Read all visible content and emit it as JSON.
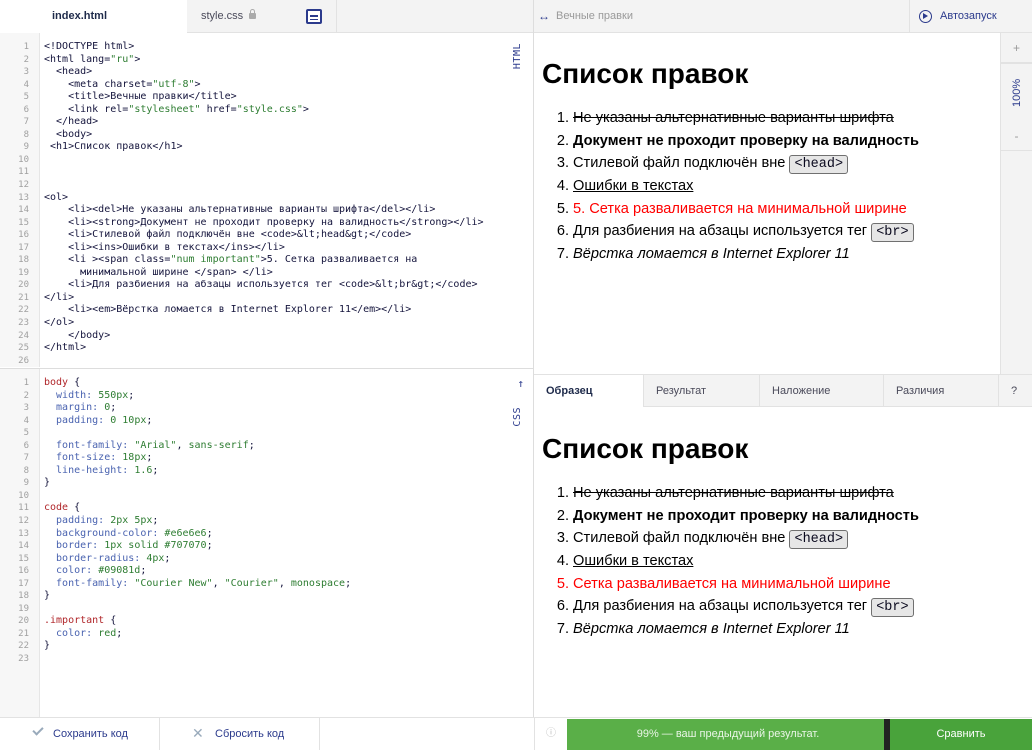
{
  "tabs": {
    "html_file": "index.html",
    "css_file": "style.css"
  },
  "preview": {
    "title": "Вечные правки",
    "autorun": "Автозапуск",
    "zoom_in": "+",
    "zoom_level": "100%",
    "zoom_out": "-"
  },
  "editors": {
    "html_label": "HTML",
    "css_label": "CSS",
    "html_line_count": 24,
    "css_line_count": 23
  },
  "page": {
    "heading": "Список правок",
    "items": [
      {
        "num": "1.",
        "text": "Не указаны альтернативные варианты шрифта"
      },
      {
        "num": "2.",
        "text": "Документ не проходит проверку на валидность"
      },
      {
        "num": "3.",
        "text": "Стилевой файл подключён вне ",
        "code": "<head>"
      },
      {
        "num": "4.",
        "text": "Ошибки в текстах"
      },
      {
        "num": "5.",
        "text": "5. Сетка разваливается на минимальной ширине"
      },
      {
        "num": "6.",
        "text": "Для разбиения на абзацы используется тег ",
        "code": "<br>"
      },
      {
        "num": "7.",
        "text": "Вёрстка ломается в Internet Explorer 11"
      }
    ]
  },
  "sample": {
    "heading": "Список правок",
    "items": [
      {
        "num": "1.",
        "text": "Не указаны альтернативные варианты шрифта"
      },
      {
        "num": "2.",
        "text": "Документ не проходит проверку на валидность"
      },
      {
        "num": "3.",
        "text": "Стилевой файл подключён вне ",
        "code": "<head>"
      },
      {
        "num": "4.",
        "text": "Ошибки в текстах"
      },
      {
        "num": "5.",
        "text": "Сетка разваливается на минимальной ширине"
      },
      {
        "num": "6.",
        "text": "Для разбиения на абзацы используется тег ",
        "code": "<br>"
      },
      {
        "num": "7.",
        "text": "Вёрстка ломается в Internet Explorer 11"
      }
    ]
  },
  "compare_tabs": {
    "sample": "Образец",
    "result": "Результат",
    "overlay": "Наложение",
    "diff": "Различия",
    "help": "?"
  },
  "bottom": {
    "save": "Сохранить код",
    "reset": "Сбросить код",
    "progress_text": "99% — ваш предыдущий результат.",
    "progress_value": 99,
    "compare": "Сравнить"
  },
  "colors": {
    "accent": "#2b3a8c",
    "progress_green": "#5aaf48",
    "compare_green": "#49a33b",
    "important_red": "#ff0000"
  },
  "html_code": [
    [
      [
        "t",
        "<!DOCTYPE html>"
      ]
    ],
    [
      [
        "t",
        "<html "
      ],
      [
        "a",
        "lang="
      ],
      [
        "v",
        "\"ru\""
      ],
      [
        "t",
        ">"
      ]
    ],
    [
      [
        "t",
        "  <head>"
      ]
    ],
    [
      [
        "t",
        "    <meta "
      ],
      [
        "a",
        "charset="
      ],
      [
        "v",
        "\"utf-8\""
      ],
      [
        "t",
        ">"
      ]
    ],
    [
      [
        "t",
        "    <title>"
      ],
      [
        "n",
        "Вечные правки"
      ],
      [
        "t",
        "</title>"
      ]
    ],
    [
      [
        "t",
        "    <link "
      ],
      [
        "a",
        "rel="
      ],
      [
        "v",
        "\"stylesheet\""
      ],
      [
        "a",
        " href="
      ],
      [
        "v",
        "\"style.css\""
      ],
      [
        "t",
        ">"
      ]
    ],
    [
      [
        "t",
        "  </head>"
      ]
    ],
    [
      [
        "t",
        "  <body>"
      ]
    ],
    [
      [
        "t",
        " <h1>"
      ],
      [
        "n",
        "Список правок"
      ],
      [
        "t",
        "</h1>"
      ]
    ],
    [
      [
        "n",
        ""
      ]
    ],
    [
      [
        "n",
        ""
      ]
    ],
    [
      [
        "n",
        ""
      ]
    ],
    [
      [
        "t",
        "<ol>"
      ]
    ],
    [
      [
        "t",
        "    <li><del>"
      ],
      [
        "n",
        "Не указаны альтернативные варианты шрифта"
      ],
      [
        "t",
        "</del></li>"
      ]
    ],
    [
      [
        "t",
        "    <li><strong>"
      ],
      [
        "n",
        "Документ не проходит проверку на валидность"
      ],
      [
        "t",
        "</strong></li>"
      ]
    ],
    [
      [
        "t",
        "    <li>"
      ],
      [
        "n",
        "Стилевой файл подключён вне "
      ],
      [
        "t",
        "<code>"
      ],
      [
        "n",
        "&lt;head&gt;"
      ],
      [
        "t",
        "</code>"
      ]
    ],
    [
      [
        "t",
        "    <li><ins>"
      ],
      [
        "n",
        "Ошибки в текстах"
      ],
      [
        "t",
        "</ins></li>"
      ]
    ],
    [
      [
        "t",
        "    <li ><span "
      ],
      [
        "a",
        "class="
      ],
      [
        "v",
        "\"num important\""
      ],
      [
        "t",
        ">"
      ],
      [
        "n",
        "5. Сетка разваливается на"
      ]
    ],
    [
      [
        "n",
        "      минимальной ширине "
      ],
      [
        "t",
        "</span> </li>"
      ]
    ],
    [
      [
        "t",
        "    <li>"
      ],
      [
        "n",
        "Для разбиения на абзацы используется тег "
      ],
      [
        "t",
        "<code>"
      ],
      [
        "n",
        "&lt;br&gt;"
      ],
      [
        "t",
        "</code>"
      ]
    ],
    [
      [
        "t",
        "</li>"
      ]
    ],
    [
      [
        "t",
        "    <li><em>"
      ],
      [
        "n",
        "Вёрстка ломается в Internet Explorer 11"
      ],
      [
        "t",
        "</em></li>"
      ]
    ],
    [
      [
        "t",
        "</ol>"
      ]
    ],
    [
      [
        "t",
        "    </body>"
      ]
    ],
    [
      [
        "t",
        "</html>"
      ]
    ],
    [
      [
        "n",
        ""
      ]
    ]
  ],
  "css_code": [
    [
      [
        "sel",
        "body "
      ],
      [
        "n",
        "{"
      ]
    ],
    [
      [
        "p",
        "  width: "
      ],
      [
        "v",
        "550px"
      ],
      [
        "n",
        ";"
      ]
    ],
    [
      [
        "p",
        "  margin: "
      ],
      [
        "v",
        "0"
      ],
      [
        "n",
        ";"
      ]
    ],
    [
      [
        "p",
        "  padding: "
      ],
      [
        "v",
        "0 10px"
      ],
      [
        "n",
        ";"
      ]
    ],
    [
      [
        "n",
        ""
      ]
    ],
    [
      [
        "p",
        "  font-family: "
      ],
      [
        "v",
        "\"Arial\""
      ],
      [
        "n",
        ", "
      ],
      [
        "v",
        "sans-serif"
      ],
      [
        "n",
        ";"
      ]
    ],
    [
      [
        "p",
        "  font-size: "
      ],
      [
        "v",
        "18px"
      ],
      [
        "n",
        ";"
      ]
    ],
    [
      [
        "p",
        "  line-height: "
      ],
      [
        "v",
        "1.6"
      ],
      [
        "n",
        ";"
      ]
    ],
    [
      [
        "n",
        "}"
      ]
    ],
    [
      [
        "n",
        ""
      ]
    ],
    [
      [
        "sel",
        "code "
      ],
      [
        "n",
        "{"
      ]
    ],
    [
      [
        "p",
        "  padding: "
      ],
      [
        "v",
        "2px 5px"
      ],
      [
        "n",
        ";"
      ]
    ],
    [
      [
        "p",
        "  background-color: "
      ],
      [
        "v",
        "#e6e6e6"
      ],
      [
        "n",
        ";"
      ]
    ],
    [
      [
        "p",
        "  border: "
      ],
      [
        "v",
        "1px solid #707070"
      ],
      [
        "n",
        ";"
      ]
    ],
    [
      [
        "p",
        "  border-radius: "
      ],
      [
        "v",
        "4px"
      ],
      [
        "n",
        ";"
      ]
    ],
    [
      [
        "p",
        "  color: "
      ],
      [
        "v",
        "#09081d"
      ],
      [
        "n",
        ";"
      ]
    ],
    [
      [
        "p",
        "  font-family: "
      ],
      [
        "v",
        "\"Courier New\""
      ],
      [
        "n",
        ", "
      ],
      [
        "v",
        "\"Courier\""
      ],
      [
        "n",
        ", "
      ],
      [
        "v",
        "monospace"
      ],
      [
        "n",
        ";"
      ]
    ],
    [
      [
        "n",
        "}"
      ]
    ],
    [
      [
        "n",
        ""
      ]
    ],
    [
      [
        "sel",
        ".important "
      ],
      [
        "n",
        "{"
      ]
    ],
    [
      [
        "p",
        "  color: "
      ],
      [
        "v",
        "red"
      ],
      [
        "n",
        ";"
      ]
    ],
    [
      [
        "n",
        "}"
      ]
    ],
    [
      [
        "n",
        ""
      ]
    ]
  ]
}
